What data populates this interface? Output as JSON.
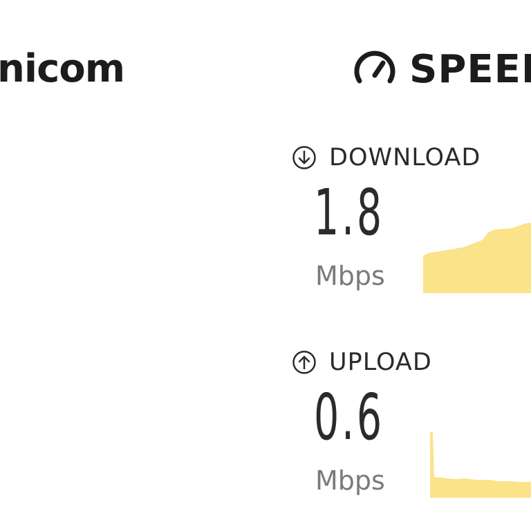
{
  "carrier": {
    "name": "nicom"
  },
  "brand": {
    "name": "SPEEI",
    "gauge_icon": "speedometer-icon"
  },
  "download": {
    "label": "DOWNLOAD",
    "icon": "arrow-down-circle-icon",
    "value": "1.8",
    "unit": "Mbps",
    "graph_color": "#fbe38a"
  },
  "upload": {
    "label": "UPLOAD",
    "icon": "arrow-up-circle-icon",
    "value": "0.6",
    "unit": "Mbps",
    "graph_color": "#fbe38a"
  }
}
